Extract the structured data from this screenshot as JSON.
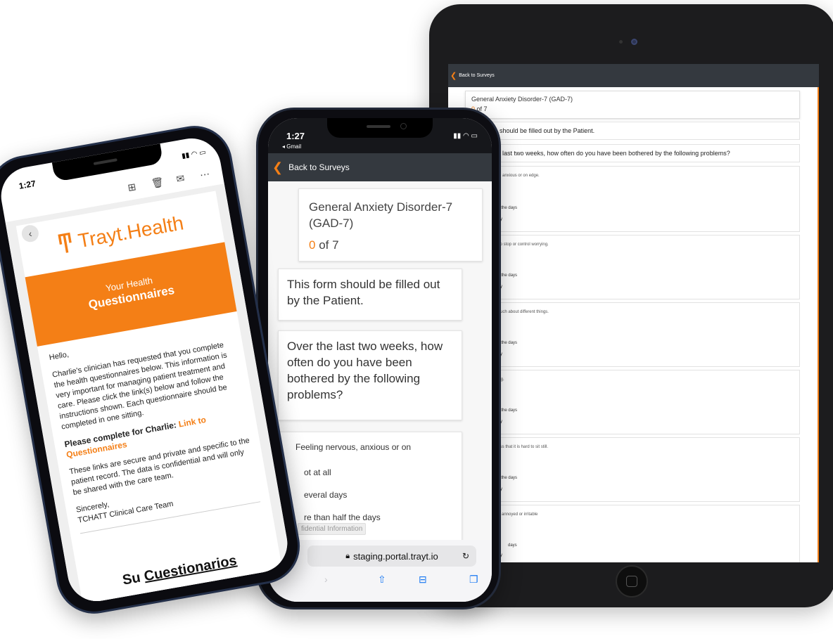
{
  "tablet": {
    "nav_back": "Back to Surveys",
    "title": "General Anxiety Disorder-7 (GAD-7)",
    "progress_current": "0",
    "progress_rest": " of 7",
    "info": "m should be filled out by the Patient.",
    "question": "last two weeks, how often do you have been bothered by the following problems?",
    "items": [
      {
        "label": "rvous, anxious or on edge.",
        "options": [
          "ays",
          "n half the days",
          "eryday"
        ]
      },
      {
        "label": "able to stop or control worrying.",
        "options": [
          "ays",
          "n half the days",
          "eryday"
        ]
      },
      {
        "label": "too much about different things.",
        "options": [
          "ays",
          "n half the days",
          "eryday"
        ]
      },
      {
        "label": "elaxing.",
        "options": [
          "ays",
          "n half the days",
          "eryday"
        ]
      },
      {
        "label": "restless that it is hard to sit still.",
        "options": [
          "ays",
          "n half the days",
          "eryday"
        ]
      },
      {
        "label": "easily annoyed or irritable",
        "options": [
          "ays",
          "days",
          "eryday"
        ]
      }
    ]
  },
  "phone_right": {
    "time": "1:27",
    "back_app": "◂ Gmail",
    "nav_back": "Back to Surveys",
    "title": "General Anxiety Disorder-7 (GAD-7)",
    "progress_current": "0",
    "progress_rest": " of 7",
    "info": "This form should be filled out by the Patient.",
    "question": "Over the last two weeks, how often do you have been bothered by the following problems?",
    "item_label": "Feeling nervous, anxious or on",
    "options": [
      "ot at all",
      "everal days",
      "re than half the days"
    ],
    "confidential": "fidential Information",
    "url": "staging.portal.trayt.io"
  },
  "phone_left": {
    "time": "1:27",
    "brand": "Trayt.Health",
    "banner_line1": "Your Health",
    "banner_line2": "Questionnaires",
    "greeting": "Hello,",
    "body": "Charlie's clinician has requested that you complete the health questionnaires below. This information is very important for managing patient treatment and care. Please click the link(s) below and follow the instructions shown. Each questionnaire should be completed in one sitting.",
    "cta_text": "Please complete for Charlie: ",
    "cta_link": "Link to Questionnaires",
    "secure_text": "These links are secure and private and specific to the patient record. The data is confidential and will only be shared with the care team.",
    "sign1": "Sincerely,",
    "sign2": "TCHATT Clinical Care Team",
    "spanish_prefix": "Su ",
    "spanish_word": "Cuestionarios"
  }
}
